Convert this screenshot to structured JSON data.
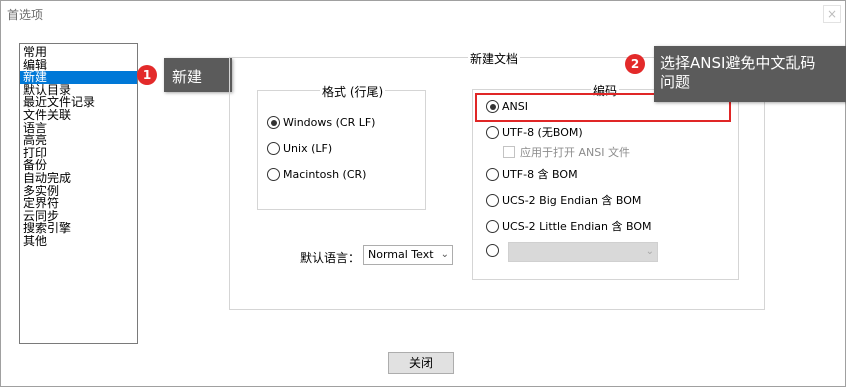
{
  "window": {
    "title": "首选项",
    "close_glyph": "×"
  },
  "categories": [
    {
      "label": "常用",
      "selected": false
    },
    {
      "label": "编辑",
      "selected": false
    },
    {
      "label": "新建",
      "selected": true
    },
    {
      "label": "默认目录",
      "selected": false
    },
    {
      "label": "最近文件记录",
      "selected": false
    },
    {
      "label": "文件关联",
      "selected": false
    },
    {
      "label": "语言",
      "selected": false
    },
    {
      "label": "高亮",
      "selected": false
    },
    {
      "label": "打印",
      "selected": false
    },
    {
      "label": "备份",
      "selected": false
    },
    {
      "label": "自动完成",
      "selected": false
    },
    {
      "label": "多实例",
      "selected": false
    },
    {
      "label": "定界符",
      "selected": false
    },
    {
      "label": "云同步",
      "selected": false
    },
    {
      "label": "搜索引擎",
      "selected": false
    },
    {
      "label": "其他",
      "selected": false
    }
  ],
  "callouts": {
    "one": {
      "number": "1",
      "text": "新建"
    },
    "two": {
      "number": "2",
      "line1": "选择ANSI避免中文乱码",
      "line2": "问题"
    }
  },
  "new_doc": {
    "group_title": "新建文档",
    "format": {
      "title": "格式 (行尾)",
      "options": [
        "Windows (CR LF)",
        "Unix (LF)",
        "Macintosh (CR)"
      ],
      "selected": "Windows (CR LF)"
    },
    "encoding": {
      "title": "编码",
      "options": [
        "ANSI",
        "UTF-8 (无BOM)",
        "UTF-8 含 BOM",
        "UCS-2 Big Endian 含 BOM",
        "UCS-2 Little Endian 含 BOM"
      ],
      "selected": "ANSI",
      "apply_checkbox": {
        "label": "应用于打开 ANSI 文件",
        "checked": false,
        "enabled": false
      },
      "other_combo_value": ""
    },
    "default_language": {
      "label": "默认语言：",
      "value": "Normal Text"
    }
  },
  "footer": {
    "close_label": "关闭"
  },
  "colors": {
    "selection": "#0078d7",
    "callout_bg": "#5b5b5b",
    "badge": "#e32a2a",
    "highlight_border": "#e02626"
  }
}
